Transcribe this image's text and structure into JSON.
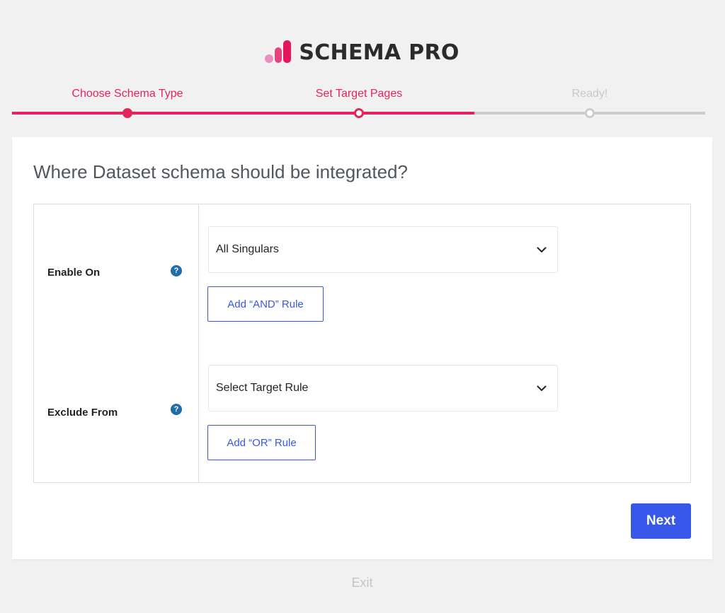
{
  "brand": {
    "name": "SCHEMA PRO",
    "colors": {
      "accent": "#e5245b",
      "primary": "#3858e9",
      "inactive": "#cccccc"
    }
  },
  "steps": [
    {
      "label": "Choose Schema Type",
      "state": "done"
    },
    {
      "label": "Set Target Pages",
      "state": "current"
    },
    {
      "label": "Ready!",
      "state": "pending"
    }
  ],
  "card": {
    "title": "Where Dataset schema should be integrated?",
    "enable_on": {
      "label": "Enable On",
      "help": "?",
      "selected": "All Singulars",
      "add_rule_label": "Add “AND” Rule"
    },
    "exclude_from": {
      "label": "Exclude From",
      "help": "?",
      "selected": "Select Target Rule",
      "add_rule_label": "Add “OR” Rule"
    },
    "next_label": "Next"
  },
  "footer": {
    "exit_label": "Exit"
  },
  "icons": {
    "help": "question-circle-icon",
    "dropdown": "chevron-down-icon"
  }
}
